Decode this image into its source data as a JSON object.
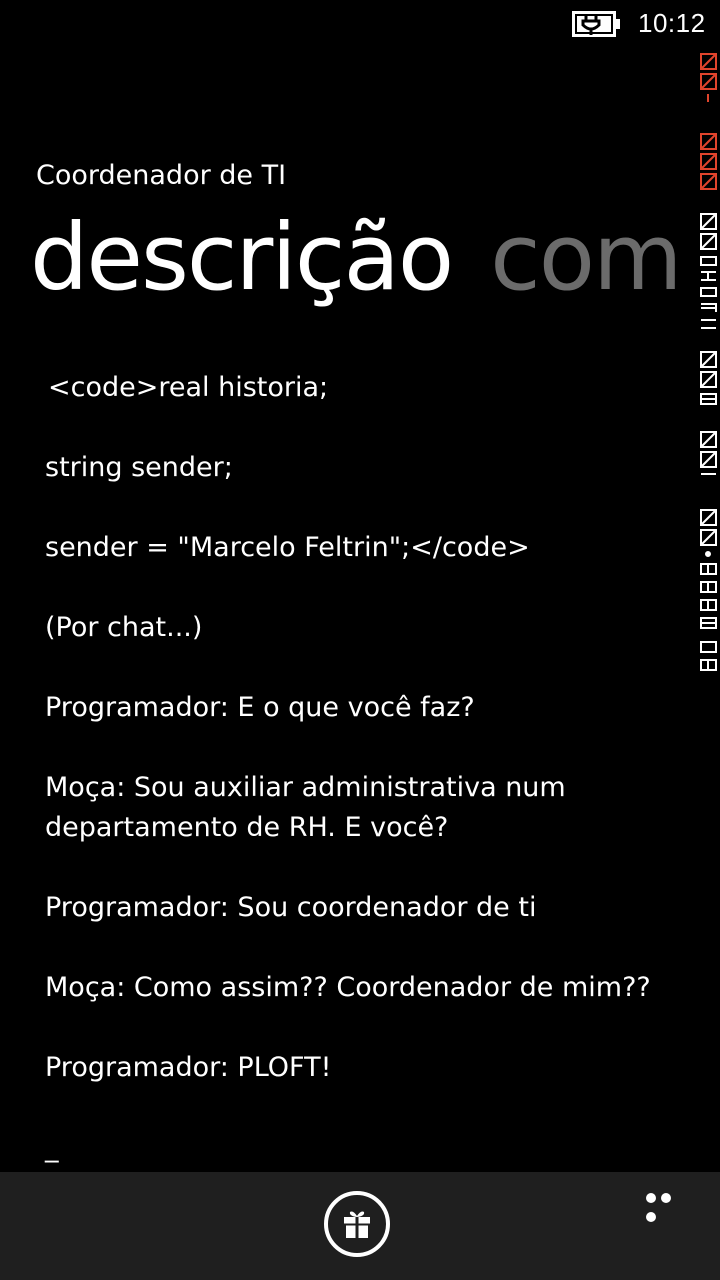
{
  "status_bar": {
    "time": "10:12",
    "battery_icon": "battery-charging-icon"
  },
  "debug_counter": {
    "values": [
      "222",
      "222",
      "0215432",
      "008",
      "001",
      "5955.02"
    ],
    "accent_color": "#e0442c"
  },
  "app_title": "Coordenador de TI",
  "pivot": {
    "items": [
      {
        "label": "descrição",
        "active": true
      },
      {
        "label": "com",
        "active": false
      }
    ]
  },
  "content": {
    "paragraphs": [
      "<code>real historia;",
      "string sender;",
      "sender = \"Marcelo Feltrin\";</code>",
      "(Por chat...)",
      "Programador: E o que você faz?",
      "Moça: Sou auxiliar administrativa num departamento de RH. E você?",
      "Programador: Sou coordenador de ti",
      "Moça: Como assim?? Coordenador de mim??",
      "Programador: PLOFT!",
      "_"
    ]
  },
  "app_bar": {
    "primary_icon": "gift-icon",
    "more_icon": "more-dots-icon",
    "background": "#1f1f1f"
  }
}
